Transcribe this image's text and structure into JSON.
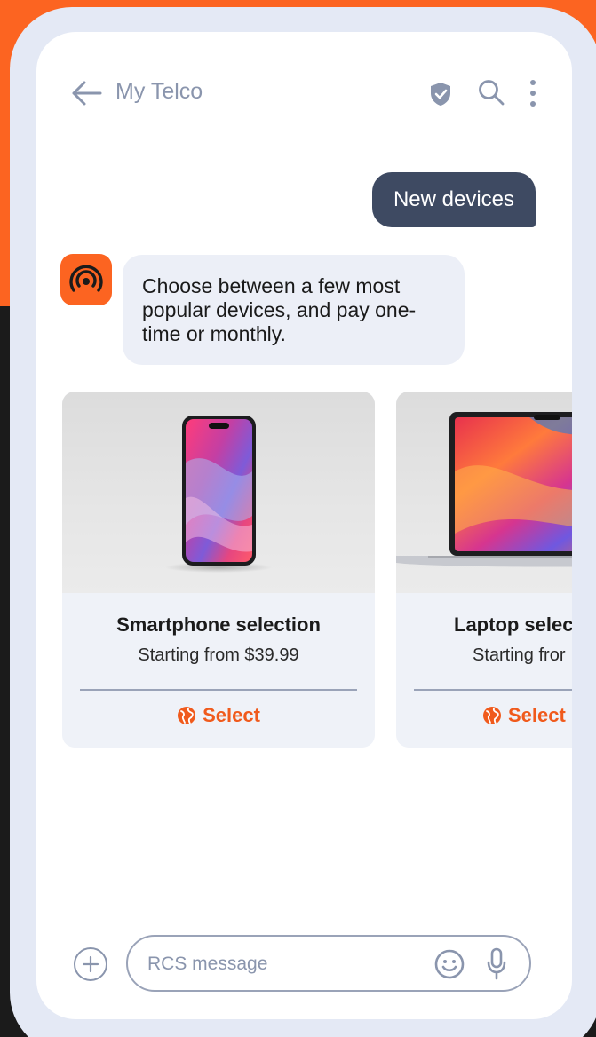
{
  "colors": {
    "brand": "#fc6421",
    "accent": "#f05a1c",
    "outgoing_bubble": "#3e4a62",
    "incoming_bubble": "#eceff7"
  },
  "header": {
    "title": "My Telco",
    "icons": [
      "back-arrow-icon",
      "verified-shield-icon",
      "search-icon",
      "more-vertical-icon"
    ]
  },
  "messages": {
    "outgoing": "New devices",
    "incoming": "Choose between a few most popular devices, and pay one-time or monthly."
  },
  "cards": [
    {
      "title": "Smartphone selection",
      "subtitle": "Starting from $39.99",
      "action_label": "Select",
      "action_icon": "globe-icon",
      "media": "smartphone-image"
    },
    {
      "title": "Laptop selec",
      "subtitle": "Starting fror",
      "action_label": "Select",
      "action_icon": "globe-icon",
      "media": "laptop-image"
    }
  ],
  "composer": {
    "placeholder": "RCS message",
    "icons": [
      "add-icon",
      "emoji-icon",
      "microphone-icon"
    ]
  }
}
